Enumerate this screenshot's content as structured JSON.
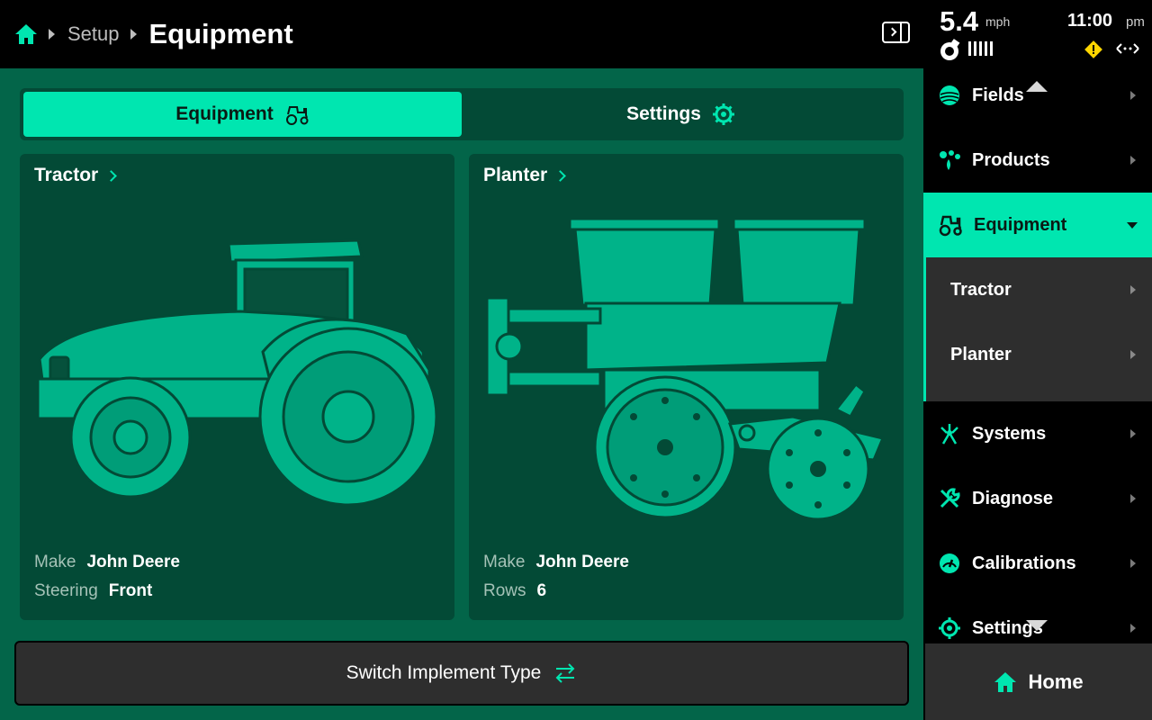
{
  "header": {
    "breadcrumb_parent": "Setup",
    "title": "Equipment"
  },
  "status": {
    "speed": "5.4",
    "speed_unit": "mph",
    "time": "11:00",
    "ampm": "pm"
  },
  "tabs": [
    {
      "label": "Equipment",
      "active": true
    },
    {
      "label": "Settings",
      "active": false
    }
  ],
  "cards": {
    "tractor": {
      "title": "Tractor",
      "make_label": "Make",
      "make_value": "John Deere",
      "steering_label": "Steering",
      "steering_value": "Front"
    },
    "planter": {
      "title": "Planter",
      "make_label": "Make",
      "make_value": "John Deere",
      "rows_label": "Rows",
      "rows_value": "6"
    }
  },
  "switch_button": {
    "label": "Switch Implement Type"
  },
  "nav": {
    "items": [
      {
        "label": "Fields",
        "icon": "fields-icon"
      },
      {
        "label": "Products",
        "icon": "products-icon"
      },
      {
        "label": "Equipment",
        "icon": "tractor-icon",
        "active": true
      },
      {
        "label": "Systems",
        "icon": "systems-icon"
      },
      {
        "label": "Diagnose",
        "icon": "wrench-icon"
      },
      {
        "label": "Calibrations",
        "icon": "gauge-icon"
      },
      {
        "label": "Settings",
        "icon": "gear-icon"
      }
    ],
    "subitems": [
      {
        "label": "Tractor"
      },
      {
        "label": "Planter"
      }
    ]
  },
  "home_button": {
    "label": "Home"
  },
  "colors": {
    "accent": "#00e6b0",
    "main_bg": "#036549",
    "card_bg": "#034a36",
    "art": "#00b389",
    "warning": "#ffd600"
  }
}
